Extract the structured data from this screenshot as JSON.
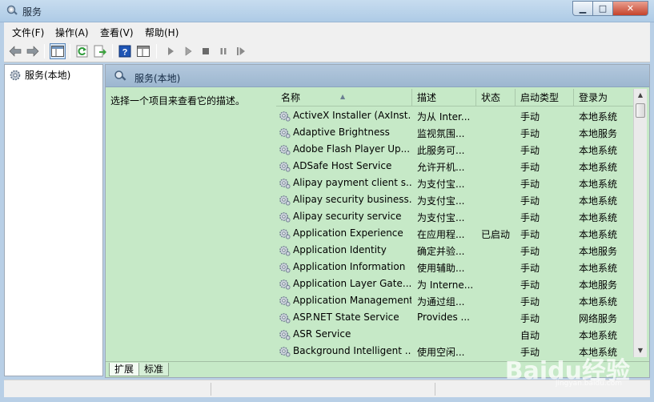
{
  "window": {
    "title": "服务"
  },
  "menu": [
    "文件(F)",
    "操作(A)",
    "查看(V)",
    "帮助(H)"
  ],
  "tree": {
    "root": "服务(本地)"
  },
  "panel": {
    "title": "服务(本地)",
    "description": "选择一个项目来查看它的描述。"
  },
  "columns": {
    "name": "名称",
    "desc": "描述",
    "status": "状态",
    "startup": "启动类型",
    "logon": "登录为"
  },
  "rows": [
    {
      "name": "ActiveX Installer (AxInst...",
      "desc": "为从 Inter...",
      "status": "",
      "startup": "手动",
      "logon": "本地系统"
    },
    {
      "name": "Adaptive Brightness",
      "desc": "监视氛围...",
      "status": "",
      "startup": "手动",
      "logon": "本地服务"
    },
    {
      "name": "Adobe Flash Player Up...",
      "desc": "此服务可...",
      "status": "",
      "startup": "手动",
      "logon": "本地系统"
    },
    {
      "name": "ADSafe Host Service",
      "desc": "允许开机...",
      "status": "",
      "startup": "手动",
      "logon": "本地系统"
    },
    {
      "name": "Alipay payment client s...",
      "desc": "为支付宝...",
      "status": "",
      "startup": "手动",
      "logon": "本地系统"
    },
    {
      "name": "Alipay security business...",
      "desc": "为支付宝...",
      "status": "",
      "startup": "手动",
      "logon": "本地系统"
    },
    {
      "name": "Alipay security service",
      "desc": "为支付宝...",
      "status": "",
      "startup": "手动",
      "logon": "本地系统"
    },
    {
      "name": "Application Experience",
      "desc": "在应用程...",
      "status": "已启动",
      "startup": "手动",
      "logon": "本地系统"
    },
    {
      "name": "Application Identity",
      "desc": "确定并验...",
      "status": "",
      "startup": "手动",
      "logon": "本地服务"
    },
    {
      "name": "Application Information",
      "desc": "使用辅助...",
      "status": "",
      "startup": "手动",
      "logon": "本地系统"
    },
    {
      "name": "Application Layer Gate...",
      "desc": "为 Interne...",
      "status": "",
      "startup": "手动",
      "logon": "本地服务"
    },
    {
      "name": "Application Management",
      "desc": "为通过组...",
      "status": "",
      "startup": "手动",
      "logon": "本地系统"
    },
    {
      "name": "ASP.NET State Service",
      "desc": "Provides ...",
      "status": "",
      "startup": "手动",
      "logon": "网络服务"
    },
    {
      "name": "ASR Service",
      "desc": "",
      "status": "",
      "startup": "自动",
      "logon": "本地系统"
    },
    {
      "name": "Background Intelligent ...",
      "desc": "使用空闲...",
      "status": "",
      "startup": "手动",
      "logon": "本地系统"
    }
  ],
  "tabs": [
    "扩展",
    "标准"
  ],
  "watermark": {
    "brand": "Baidu经验",
    "url": "jingyan.baidu.com"
  }
}
